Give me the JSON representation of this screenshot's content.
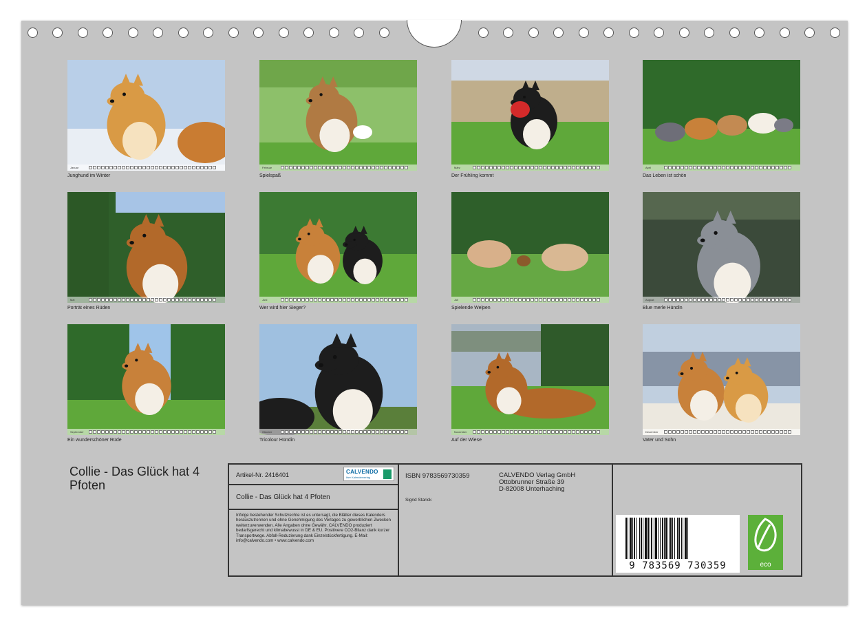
{
  "months": [
    {
      "caption": "Junghund im Winter",
      "month_label": "Januar",
      "scene": "sable-puppy-snow"
    },
    {
      "caption": "Spielspaß",
      "month_label": "Februar",
      "scene": "sable-rope-grass"
    },
    {
      "caption": "Der Frühling kommt",
      "month_label": "März",
      "scene": "tricolor-ball-meadow"
    },
    {
      "caption": "Das Leben ist schön",
      "month_label": "April",
      "scene": "group-running-grass"
    },
    {
      "caption": "Porträt eines Rüden",
      "month_label": "Mai",
      "scene": "sable-portrait-trees"
    },
    {
      "caption": "Wer wird hier Sieger?",
      "month_label": "Juni",
      "scene": "two-dogs-rope"
    },
    {
      "caption": "Spielende Welpen",
      "month_label": "Juli",
      "scene": "puppies-playing"
    },
    {
      "caption": "Blue merle Hündin",
      "month_label": "August",
      "scene": "blue-merle-portrait"
    },
    {
      "caption": "Ein wunderschöner Rüde",
      "month_label": "September",
      "scene": "sable-sitting-meadow"
    },
    {
      "caption": "Tricolour Hündin",
      "month_label": "Oktober",
      "scene": "tricolor-sky"
    },
    {
      "caption": "Auf der Wiese",
      "month_label": "November",
      "scene": "sable-lying-meadow"
    },
    {
      "caption": "Vater und Sohn",
      "month_label": "Dezember",
      "scene": "two-sables-snow"
    }
  ],
  "title": "Collie - Das Glück hat 4 Pfoten",
  "info": {
    "article_number": "Artikel-Nr. 2416401",
    "logo_text": "CALVENDO",
    "logo_subtext": "Ihre Kalenderverlag",
    "product_name": "Collie - Das Glück hat 4 Pfoten",
    "legal_text": "Infolge bestehender Schutzrechte ist es untersagt, die Blätter dieses Kalenders herauszutrennen und ohne Genehmigung des Verlages zu gewerblichen Zwecken weiterzuverwenden. Alle Angaben ohne Gewähr. CALVENDO produziert bedarfsgerecht und klimabewusst in DE & EU. Positivere CO2-Bilanz dank kurzer Transportwege. Abfall-Reduzierung dank Einzelstückfertigung. E-Mail: info@calvendo.com • www.calvendo.com",
    "isbn": "ISBN 9783569730359",
    "author": "Sigrid Starick",
    "publisher_name": "CALVENDO Verlag GmbH",
    "publisher_street": "Ottobrunner Straße 39",
    "publisher_city": "D-82008 Unterhaching",
    "barcode_number": "9 783569 730359",
    "eco_label": "eco"
  },
  "colors": {
    "page_background": "#c4c4c4",
    "eco_green": "#5cb03a",
    "calvendo_blue": "#0a6aa3"
  }
}
